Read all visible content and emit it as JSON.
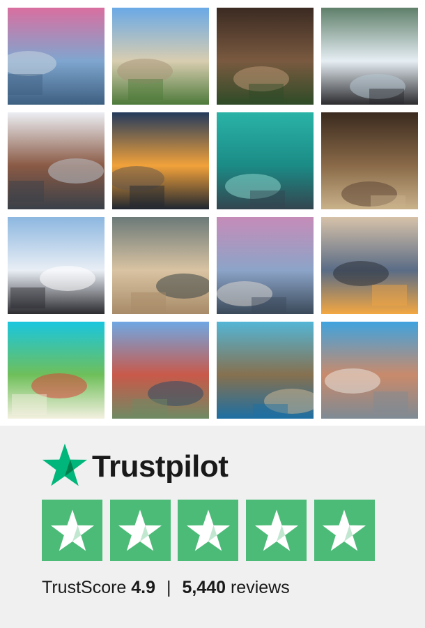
{
  "gallery": {
    "tiles": [
      {
        "name": "reykjavik-harbor-photo",
        "colors": [
          "#d96fa0",
          "#7fa6cf",
          "#3d5f80",
          "#c9d4de"
        ]
      },
      {
        "name": "french-villa-photo",
        "colors": [
          "#6aa9e6",
          "#d8cdb0",
          "#4d7a3a",
          "#a9987a"
        ]
      },
      {
        "name": "riad-courtyard-photo",
        "colors": [
          "#3b2a22",
          "#7a5a40",
          "#2e4b27",
          "#b89572"
        ]
      },
      {
        "name": "husky-dogs-snow-photo",
        "colors": [
          "#5f7f6a",
          "#e6eef4",
          "#2b2b2e",
          "#b7c7d2"
        ]
      },
      {
        "name": "bruges-canal-photo",
        "colors": [
          "#eceef3",
          "#8a5a45",
          "#394049",
          "#b9c1c8"
        ]
      },
      {
        "name": "sunset-beach-photo",
        "colors": [
          "#243a5c",
          "#f2a23a",
          "#1f2630",
          "#6a5a4a"
        ]
      },
      {
        "name": "overwater-villa-photo",
        "colors": [
          "#2ab3a7",
          "#1b8b86",
          "#33454f",
          "#8ad6cc"
        ]
      },
      {
        "name": "thatched-lounge-photo",
        "colors": [
          "#3a2a1f",
          "#8a6a48",
          "#c9b28b",
          "#5c4634"
        ]
      },
      {
        "name": "glass-igloo-photo",
        "colors": [
          "#8db7e0",
          "#e9eef5",
          "#2b2b30",
          "#ffffff"
        ]
      },
      {
        "name": "lion-portrait-photo",
        "colors": [
          "#6c7a78",
          "#d9c3a2",
          "#a88b68",
          "#3d4646"
        ]
      },
      {
        "name": "city-street-aerial-photo",
        "colors": [
          "#c58cb8",
          "#8ca4c8",
          "#3b4a5a",
          "#d9d6cf"
        ]
      },
      {
        "name": "havana-bus-sunset-photo",
        "colors": [
          "#d7c2a9",
          "#5a6c86",
          "#f3a742",
          "#2e3238"
        ]
      },
      {
        "name": "tropical-boats-aerial-photo",
        "colors": [
          "#19c6df",
          "#6fbf5a",
          "#f3f0e0",
          "#d9443a"
        ]
      },
      {
        "name": "venice-canal-photo",
        "colors": [
          "#6fa8e4",
          "#c9594a",
          "#6f8a63",
          "#2f4b66"
        ]
      },
      {
        "name": "sea-cave-boat-photo",
        "colors": [
          "#53b6d6",
          "#86704f",
          "#1d6fa3",
          "#c9b594"
        ]
      },
      {
        "name": "vintage-blue-car-photo",
        "colors": [
          "#3fa3df",
          "#c98a6b",
          "#7e8a94",
          "#e9e3dd"
        ]
      }
    ]
  },
  "trustpilot": {
    "brand_name": "Trustpilot",
    "brand_color": "#00b67a",
    "rating_box_color": "#4dbb78",
    "stars_count": 5,
    "score_label": "TrustScore",
    "score_value": "4.9",
    "separator": "|",
    "reviews_count": "5,440",
    "reviews_label": "reviews",
    "icon": "star-icon"
  }
}
